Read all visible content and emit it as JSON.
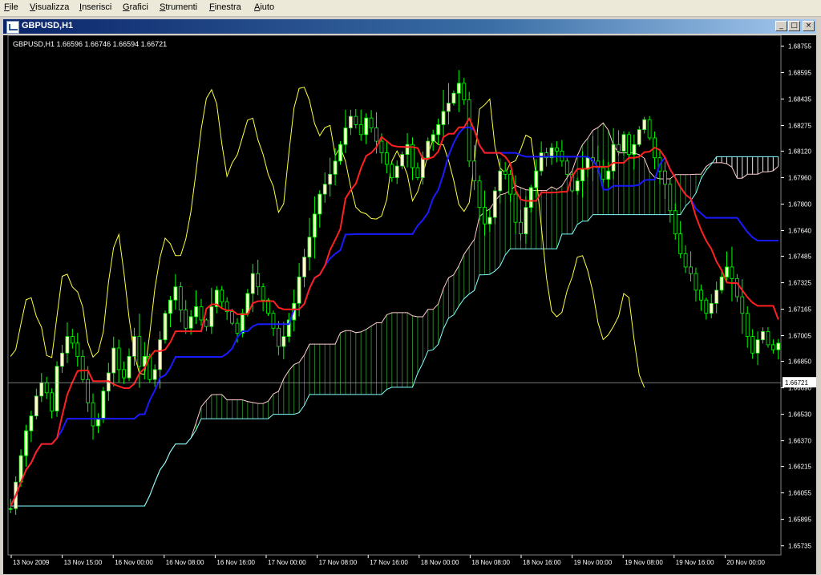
{
  "menu": [
    "File",
    "Visualizza",
    "Inserisci",
    "Grafici",
    "Strumenti",
    "Finestra",
    "Aiuto"
  ],
  "window": {
    "title": "GBPUSD,H1",
    "icon": "chart-window-icon",
    "buttons": {
      "minimize": "_",
      "maximize": "□",
      "close": "×"
    }
  },
  "chart": {
    "info": "GBPUSD,H1  1.66596 1.66746 1.66594 1.66721",
    "current_price": "1.66721"
  },
  "colors": {
    "background": "#000000",
    "candle": "#00ff00",
    "bull_body": "#ffffcc",
    "bear_body": "#000000",
    "tenkan": "#ff2020",
    "kijun": "#1a1aff",
    "chikou": "#ffff40",
    "span_a": "#ffcccc",
    "span_b": "#80ffff",
    "kumo_bear_hatch": "#ffffff",
    "kumo_bull_hatch": "#2e8b2e",
    "price_line": "#c0c0c0"
  },
  "chart_data": {
    "type": "candlestick",
    "symbol": "GBPUSD",
    "timeframe": "H1",
    "price_ticks": [
      "1.68755",
      "1.68595",
      "1.68435",
      "1.68275",
      "1.68120",
      "1.67960",
      "1.67800",
      "1.67640",
      "1.67485",
      "1.67325",
      "1.67165",
      "1.67005",
      "1.66850",
      "1.66690",
      "1.66530",
      "1.66370",
      "1.66215",
      "1.66055",
      "1.65895",
      "1.65735"
    ],
    "time_ticks": [
      "13 Nov 2009",
      "13 Nov 15:00",
      "16 Nov 00:00",
      "16 Nov 08:00",
      "16 Nov 16:00",
      "17 Nov 00:00",
      "17 Nov 08:00",
      "17 Nov 16:00",
      "18 Nov 00:00",
      "18 Nov 08:00",
      "18 Nov 16:00",
      "19 Nov 00:00",
      "19 Nov 08:00",
      "19 Nov 16:00",
      "20 Nov 00:00"
    ],
    "ylim": [
      1.6568,
      1.6882
    ],
    "bars": 150,
    "current": 1.66721,
    "closes": [
      1.6596,
      1.6612,
      1.6628,
      1.6643,
      1.6652,
      1.6664,
      1.6672,
      1.6666,
      1.6655,
      1.6682,
      1.669,
      1.67,
      1.6696,
      1.6688,
      1.6674,
      1.666,
      1.6646,
      1.665,
      1.6667,
      1.6678,
      1.6693,
      1.668,
      1.6675,
      1.6688,
      1.67,
      1.6682,
      1.6688,
      1.6674,
      1.668,
      1.6698,
      1.6714,
      1.6722,
      1.673,
      1.6716,
      1.6705,
      1.6712,
      1.6718,
      1.671,
      1.6706,
      1.6718,
      1.6728,
      1.6721,
      1.6715,
      1.6708,
      1.6702,
      1.6714,
      1.6726,
      1.6738,
      1.673,
      1.6722,
      1.6714,
      1.6705,
      1.6694,
      1.67,
      1.671,
      1.672,
      1.6736,
      1.6748,
      1.676,
      1.6774,
      1.6786,
      1.6792,
      1.6798,
      1.6806,
      1.6816,
      1.6826,
      1.6833,
      1.6828,
      1.6822,
      1.6832,
      1.6826,
      1.6818,
      1.6811,
      1.6804,
      1.6796,
      1.6803,
      1.681,
      1.6816,
      1.6802,
      1.6796,
      1.6808,
      1.6818,
      1.6822,
      1.6828,
      1.6836,
      1.6841,
      1.6847,
      1.6853,
      1.6843,
      1.6806,
      1.6794,
      1.6778,
      1.6768,
      1.6772,
      1.6788,
      1.68,
      1.6798,
      1.6786,
      1.6769,
      1.6762,
      1.6778,
      1.679,
      1.68,
      1.6811,
      1.6808,
      1.6814,
      1.6812,
      1.6806,
      1.6798,
      1.6788,
      1.6794,
      1.6801,
      1.6808,
      1.6806,
      1.6802,
      1.6795,
      1.68,
      1.6816,
      1.6812,
      1.6822,
      1.681,
      1.6816,
      1.6825,
      1.6831,
      1.682,
      1.6808,
      1.68,
      1.6792,
      1.6776,
      1.6762,
      1.675,
      1.6742,
      1.6738,
      1.6728,
      1.6722,
      1.6714,
      1.672,
      1.6728,
      1.6736,
      1.6742,
      1.6735,
      1.6724,
      1.6714,
      1.67,
      1.669,
      1.6698,
      1.6703,
      1.6695,
      1.6692,
      1.6696,
      1.6688,
      1.6672
    ]
  }
}
